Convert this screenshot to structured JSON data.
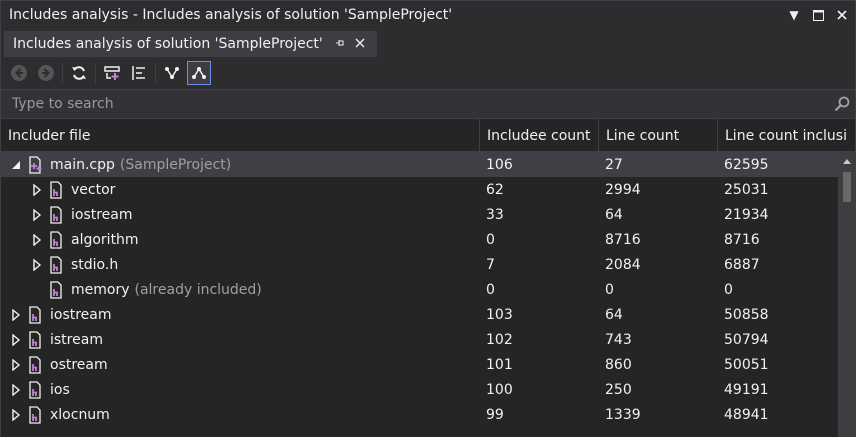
{
  "window": {
    "title": "Includes analysis - Includes analysis of solution 'SampleProject'"
  },
  "tab": {
    "label": "Includes analysis of solution 'SampleProject'"
  },
  "search": {
    "placeholder": "Type to search"
  },
  "columns": [
    "Includer file",
    "Includee count",
    "Line count",
    "Line count inclusi"
  ],
  "rows": [
    {
      "name": "main.cpp",
      "suffix": "(SampleProject)",
      "includee": "106",
      "lines": "27",
      "inclusive": "62595",
      "indent": 0,
      "expander": "expanded",
      "icon": "cpp-file-icon",
      "selected": true
    },
    {
      "name": "vector",
      "suffix": "",
      "includee": "62",
      "lines": "2994",
      "inclusive": "25031",
      "indent": 1,
      "expander": "collapsed",
      "icon": "header-file-icon"
    },
    {
      "name": "iostream",
      "suffix": "",
      "includee": "33",
      "lines": "64",
      "inclusive": "21934",
      "indent": 1,
      "expander": "collapsed",
      "icon": "header-file-icon"
    },
    {
      "name": "algorithm",
      "suffix": "",
      "includee": "0",
      "lines": "8716",
      "inclusive": "8716",
      "indent": 1,
      "expander": "collapsed",
      "icon": "header-file-icon"
    },
    {
      "name": "stdio.h",
      "suffix": "",
      "includee": "7",
      "lines": "2084",
      "inclusive": "6887",
      "indent": 1,
      "expander": "collapsed",
      "icon": "header-file-icon"
    },
    {
      "name": "memory",
      "suffix": "(already included)",
      "includee": "0",
      "lines": "0",
      "inclusive": "0",
      "indent": 1,
      "expander": "none",
      "icon": "header-file-icon"
    },
    {
      "name": "iostream",
      "suffix": "",
      "includee": "103",
      "lines": "64",
      "inclusive": "50858",
      "indent": 0,
      "expander": "collapsed",
      "icon": "header-file-icon"
    },
    {
      "name": "istream",
      "suffix": "",
      "includee": "102",
      "lines": "743",
      "inclusive": "50794",
      "indent": 0,
      "expander": "collapsed",
      "icon": "header-file-icon"
    },
    {
      "name": "ostream",
      "suffix": "",
      "includee": "101",
      "lines": "860",
      "inclusive": "50051",
      "indent": 0,
      "expander": "collapsed",
      "icon": "header-file-icon"
    },
    {
      "name": "ios",
      "suffix": "",
      "includee": "100",
      "lines": "250",
      "inclusive": "49191",
      "indent": 0,
      "expander": "collapsed",
      "icon": "header-file-icon"
    },
    {
      "name": "xlocnum",
      "suffix": "",
      "includee": "99",
      "lines": "1339",
      "inclusive": "48941",
      "indent": 0,
      "expander": "collapsed",
      "icon": "header-file-icon"
    }
  ],
  "colors": {
    "accent": "#6d8ee8",
    "icon_purple": "#c27fd8",
    "background": "#252526",
    "toolbar": "#2d2d30"
  }
}
